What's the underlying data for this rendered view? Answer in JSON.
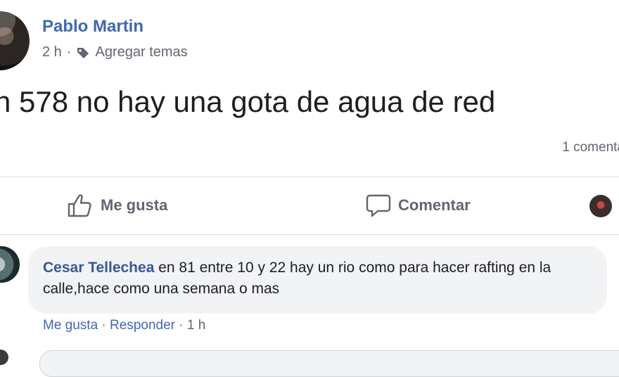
{
  "post": {
    "author": "Pablo Martin",
    "time": "2 h",
    "separator": "·",
    "tags_link": "Agregar temas",
    "text": "n 578 no hay una gota de agua de red",
    "comments_count": "1 comenta"
  },
  "actions": {
    "like_label": "Me gusta",
    "comment_label": "Comentar"
  },
  "comment": {
    "author": "Cesar Tellechea",
    "text": " en 81 entre 10 y 22 hay un rio como para hacer rafting en la calle,hace como una semana o mas",
    "like_link": "Me gusta",
    "sep1": " · ",
    "reply_link": "Responder",
    "sep2": " · ",
    "time": "1 h"
  },
  "colors": {
    "link": "#4267b2",
    "secondary_text": "#606770",
    "bubble_bg": "#f2f3f5",
    "divider": "#dadde1"
  },
  "icons": {
    "tag": "tag-icon",
    "like": "thumbs-up-icon",
    "comment": "comment-bubble-icon"
  }
}
